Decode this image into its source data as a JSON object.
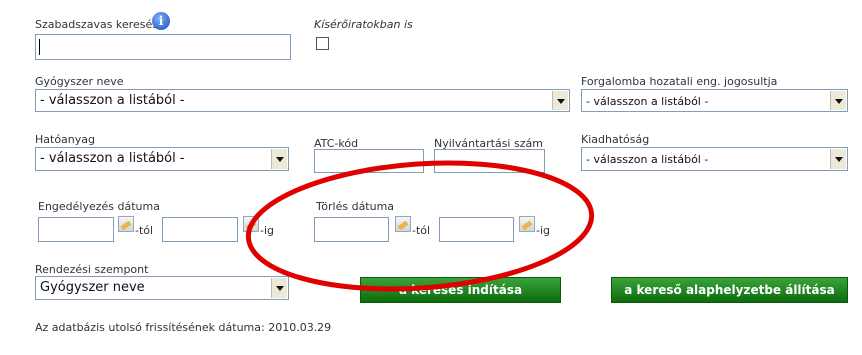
{
  "free_search": {
    "label": "Szabadszavas keresés",
    "info_icon": "info-icon",
    "value": ""
  },
  "attachments": {
    "label": "Kísérőiratokban is",
    "checked": false
  },
  "drug_name": {
    "label": "Gyógyszer neve",
    "value": "- válasszon a listából -"
  },
  "holder": {
    "label": "Forgalomba hozatali eng. jogosultja",
    "value": "- válasszon a listából -"
  },
  "active": {
    "label": "Hatóanyag",
    "value": "- válasszon a listából -"
  },
  "atc": {
    "label": "ATC-kód",
    "value": ""
  },
  "reg_no": {
    "label": "Nyilvántartási szám",
    "value": ""
  },
  "dispensing": {
    "label": "Kiadhatóság",
    "value": "- válasszon a listából -"
  },
  "approval_date": {
    "label": "Engedélyezés dátuma",
    "from_label": "-tól",
    "to_label": "-ig",
    "calendar_icon": "calendar-icon"
  },
  "deletion_date": {
    "label": "Törlés dátuma",
    "from_label": "-tól",
    "to_label": "-ig",
    "calendar_icon": "calendar-icon"
  },
  "sort": {
    "label": "Rendezési szempont",
    "value": "Gyógyszer neve"
  },
  "buttons": {
    "search": "a keresés indítása",
    "reset": "a kereső alaphelyzetbe állítása"
  },
  "footer": {
    "last_update": "Az adatbázis utolsó frissítésének dátuma: 2010.03.29"
  },
  "annotation": {
    "color": "#e00000",
    "shape": "ellipse"
  }
}
